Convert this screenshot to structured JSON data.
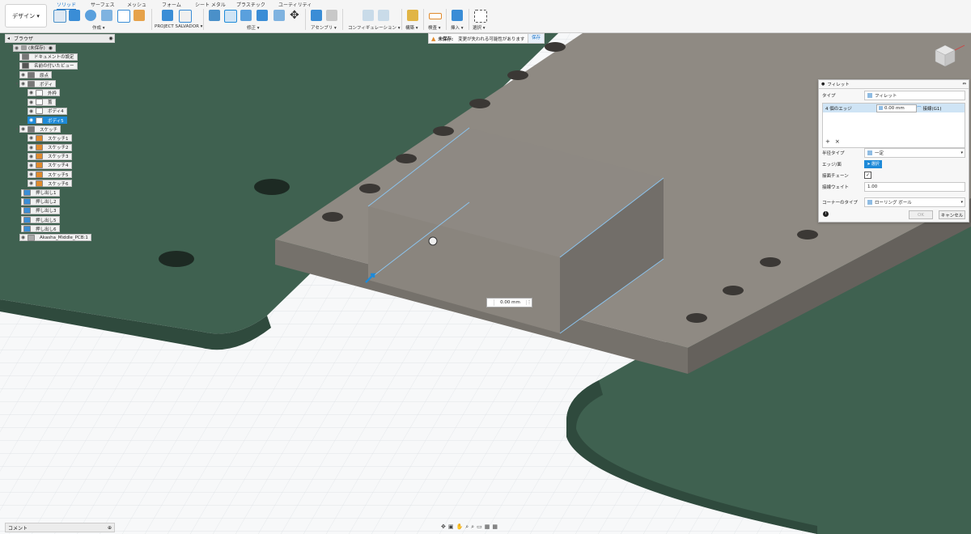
{
  "workspace": {
    "label": "デザイン ▾"
  },
  "tabs": [
    {
      "label": "ソリッド",
      "active": true
    },
    {
      "label": "サーフェス"
    },
    {
      "label": "メッシュ"
    },
    {
      "label": "フォーム"
    },
    {
      "label": "シート メタル"
    },
    {
      "label": "プラスチック"
    },
    {
      "label": "ユーティリティ"
    }
  ],
  "toolbar_groups": [
    {
      "label": "作成 ▾"
    },
    {
      "label": "PROJECT SALVADOR ▾"
    },
    {
      "label": "修正 ▾"
    },
    {
      "label": "アセンブリ ▾"
    },
    {
      "label": "コンフィギュレーション ▾"
    },
    {
      "label": "構築 ▾"
    },
    {
      "label": "検査 ▾"
    },
    {
      "label": "挿入 ▾"
    },
    {
      "label": "選択 ▾"
    }
  ],
  "browser": {
    "title": "ブラウザ",
    "root": "(未保存)",
    "items": [
      {
        "label": "ドキュメントの設定"
      },
      {
        "label": "名前の付いたビュー"
      },
      {
        "label": "原点"
      },
      {
        "label": "ボディ"
      },
      {
        "label": "外枠"
      },
      {
        "label": "蓋"
      },
      {
        "label": "ボディ4"
      },
      {
        "label": "ボディ5",
        "selected": true
      },
      {
        "label": "スケッチ"
      },
      {
        "label": "スケッチ1"
      },
      {
        "label": "スケッチ2"
      },
      {
        "label": "スケッチ3"
      },
      {
        "label": "スケッチ4"
      },
      {
        "label": "スケッチ5"
      },
      {
        "label": "スケッチ6"
      },
      {
        "label": "押し出し1"
      },
      {
        "label": "押し出し2"
      },
      {
        "label": "押し出し3"
      },
      {
        "label": "押し出し5"
      },
      {
        "label": "押し出し6"
      },
      {
        "label": "Akasha_Middle_PCB:1"
      }
    ]
  },
  "warning": {
    "label": "未保存:",
    "message": "変更が失われる可能性があります",
    "save": "保存"
  },
  "fillet_panel": {
    "title": "フィレット",
    "type_label": "タイプ",
    "type_value": "フィレット",
    "edges_label": "4 個のエッジ",
    "edges_value": "0.00 mm",
    "tangent_label": "接線(G1)",
    "radius_type_label": "半径タイプ",
    "radius_type_value": "一定",
    "edge_face_label": "エッジ/面",
    "select_label": "選択",
    "tangent_chain_label": "接面チェーン",
    "tangent_weight_label": "接線ウェイト",
    "tangent_weight_value": "1.00",
    "corner_type_label": "コーナーのタイプ",
    "corner_type_value": "ローリング ボール",
    "ok": "OK",
    "cancel": "キャンセル"
  },
  "dimension_input": {
    "value": "0.00 mm"
  },
  "comments": {
    "label": "コメント"
  },
  "colors": {
    "pcb": "#3f6150",
    "plate": "#8a857e",
    "accent": "#1e8ad8"
  }
}
